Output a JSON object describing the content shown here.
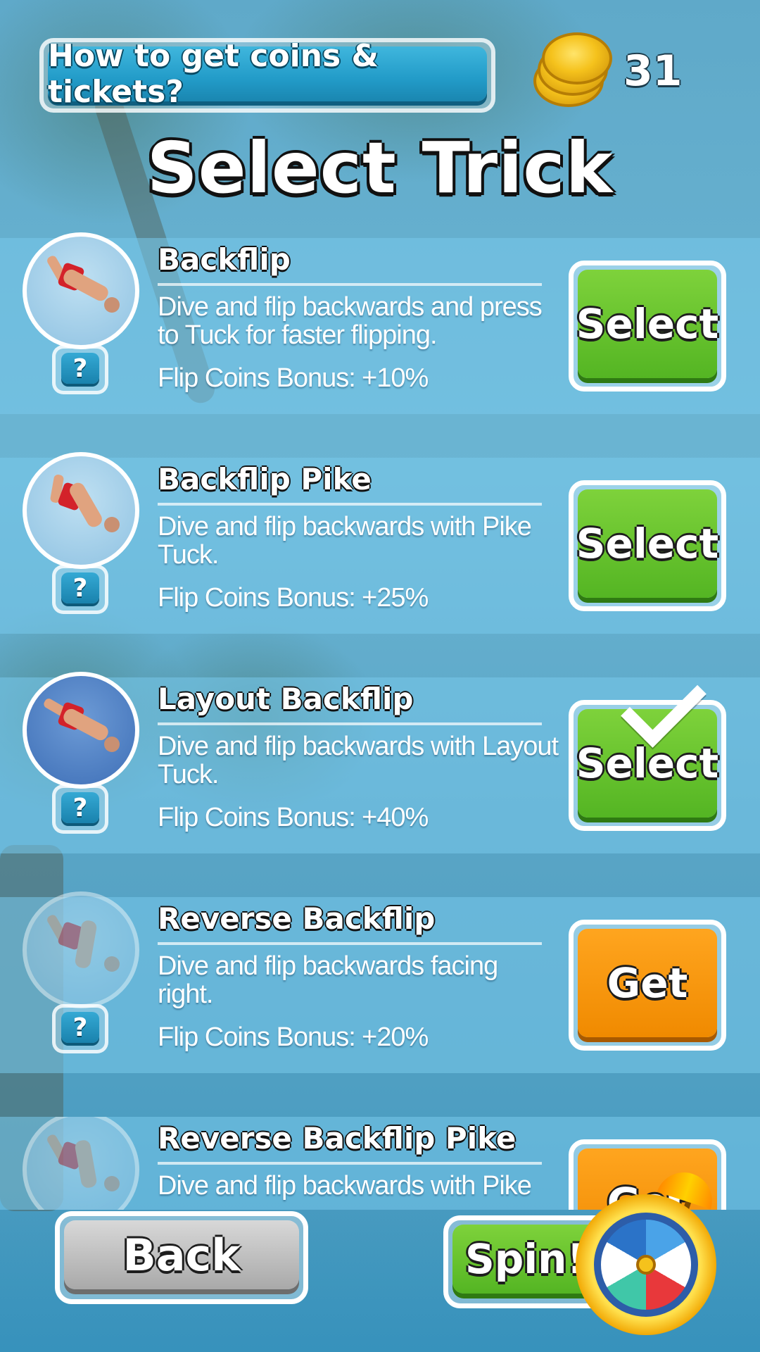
{
  "header": {
    "help_label": "How to get coins & tickets?",
    "coin_count": "31",
    "title": "Select Trick"
  },
  "tricks": [
    {
      "name": "Backflip",
      "description": "Dive and flip backwards and press to Tuck for faster flipping.",
      "bonus_label": "Flip Coins Bonus:",
      "bonus_value": "+10%",
      "action_label": "Select",
      "action_type": "select",
      "selected": false,
      "locked": false
    },
    {
      "name": "Backflip Pike",
      "description": "Dive and flip backwards with Pike Tuck.",
      "bonus_label": "Flip Coins Bonus:",
      "bonus_value": "+25%",
      "action_label": "Select",
      "action_type": "select",
      "selected": false,
      "locked": false
    },
    {
      "name": "Layout Backflip",
      "description": "Dive and flip backwards with Layout Tuck.",
      "bonus_label": "Flip Coins Bonus:",
      "bonus_value": "+40%",
      "action_label": "Select",
      "action_type": "select",
      "selected": true,
      "locked": false
    },
    {
      "name": "Reverse Backflip",
      "description": "Dive and flip backwards facing right.",
      "bonus_label": "Flip Coins Bonus:",
      "bonus_value": "+20%",
      "action_label": "Get",
      "action_type": "get",
      "selected": false,
      "locked": true
    },
    {
      "name": "Reverse Backflip Pike",
      "description": "Dive and flip backwards with Pike",
      "bonus_label": "",
      "bonus_value": "",
      "action_label": "Get",
      "action_type": "get",
      "selected": false,
      "locked": true
    }
  ],
  "help_glyph": "?",
  "footer": {
    "back_label": "Back",
    "spin_label": "Spin!"
  },
  "colors": {
    "select_green": "#54b523",
    "get_orange": "#f08a00",
    "help_blue": "#229bc8",
    "back_gray": "#a9a9a9"
  },
  "icons": {
    "coins": "coin-stack-icon",
    "help": "question-icon",
    "selected": "checkmark-icon",
    "spin": "prize-wheel-icon"
  }
}
